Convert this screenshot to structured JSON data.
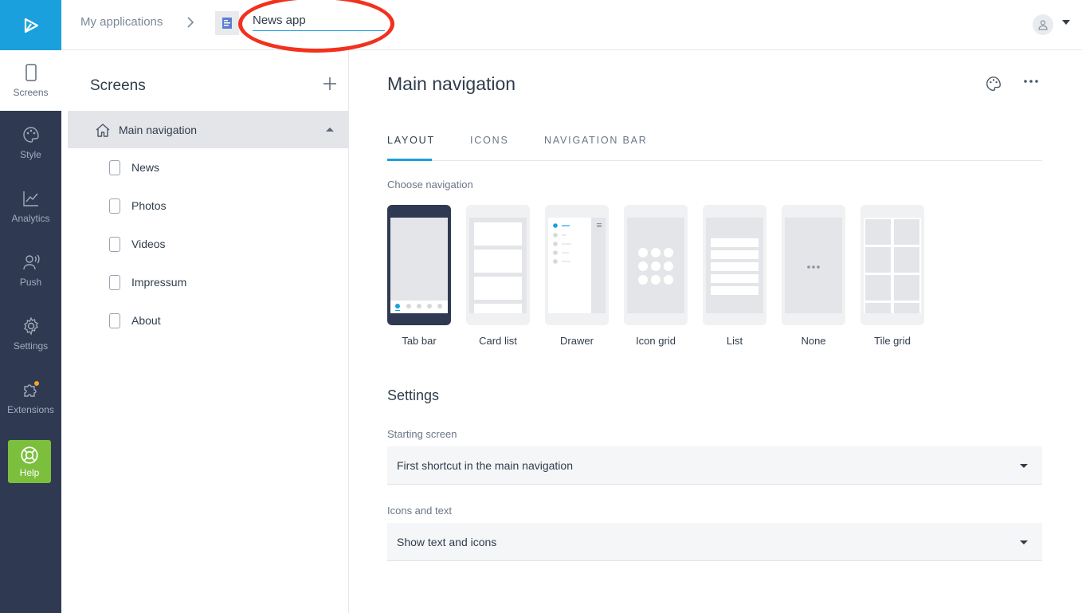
{
  "header": {
    "breadcrumb_root": "My applications",
    "app_name": "News app"
  },
  "rail": {
    "items": [
      {
        "label": "Screens",
        "icon": "phone-icon"
      },
      {
        "label": "Style",
        "icon": "palette-icon"
      },
      {
        "label": "Analytics",
        "icon": "chart-icon"
      },
      {
        "label": "Push",
        "icon": "push-icon"
      },
      {
        "label": "Settings",
        "icon": "gear-icon"
      },
      {
        "label": "Extensions",
        "icon": "puzzle-icon"
      }
    ],
    "help": "Help"
  },
  "screens_panel": {
    "title": "Screens",
    "main_nav": "Main navigation",
    "items": [
      "News",
      "Photos",
      "Videos",
      "Impressum",
      "About"
    ]
  },
  "main": {
    "title": "Main navigation",
    "tabs": [
      "LAYOUT",
      "ICONS",
      "NAVIGATION BAR"
    ],
    "choose_navigation": "Choose navigation",
    "options": [
      "Tab bar",
      "Card list",
      "Drawer",
      "Icon grid",
      "List",
      "None",
      "Tile grid"
    ],
    "selected_option": "Tab bar",
    "settings_title": "Settings",
    "starting_screen_label": "Starting screen",
    "starting_screen_value": "First shortcut in the main navigation",
    "icons_text_label": "Icons and text",
    "icons_text_value": "Show text and icons"
  },
  "colors": {
    "accent": "#1aa0dd",
    "rail_bg": "#2f3a52",
    "help_bg": "#7bbf3d",
    "annotation": "#f2311e"
  }
}
